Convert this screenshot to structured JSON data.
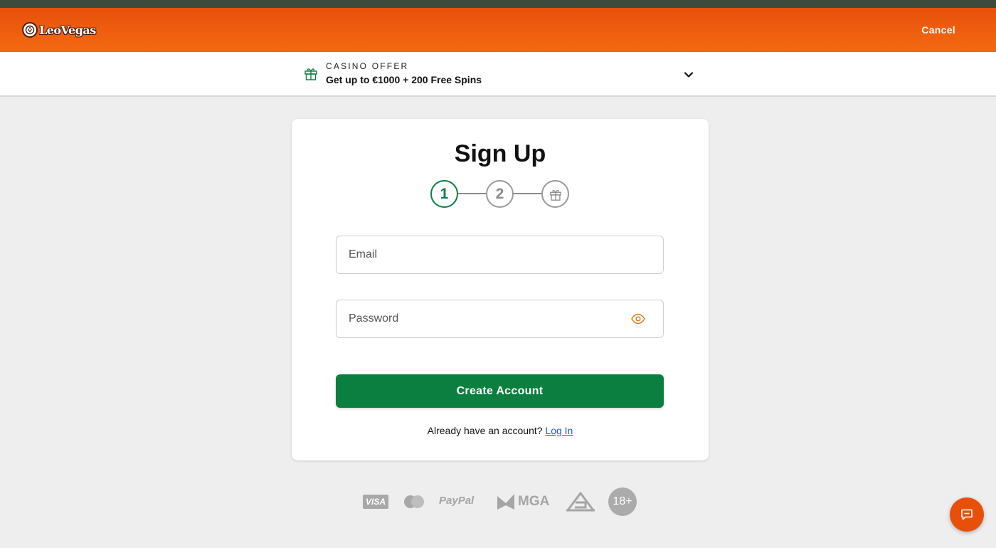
{
  "header": {
    "brand": "LeoVegas",
    "cancel_label": "Cancel"
  },
  "offer": {
    "kicker": "CASINO OFFER",
    "text": "Get up to €1000 + 200 Free Spins",
    "icon": "gift-icon"
  },
  "signup": {
    "title": "Sign Up",
    "steps": [
      {
        "label": "1",
        "state": "active"
      },
      {
        "label": "2",
        "state": "pending"
      },
      {
        "icon": "gift-icon",
        "state": "pending"
      }
    ],
    "email_placeholder": "Email",
    "password_placeholder": "Password",
    "create_label": "Create Account",
    "login_prompt": "Already have an account?",
    "login_link": "Log In"
  },
  "footer": {
    "payments": [
      {
        "name": "VISA",
        "icon": "visa-logo"
      },
      {
        "name": "Mastercard",
        "icon": "mastercard-logo"
      },
      {
        "name": "PayPal",
        "icon": "paypal-logo"
      },
      {
        "name": "MGA",
        "icon": "mga-logo"
      },
      {
        "name": "GA",
        "icon": "ga-logo"
      },
      {
        "name": "18+",
        "icon": "age-badge"
      }
    ]
  },
  "colors": {
    "brand_orange": "#e8500a",
    "primary_green": "#0b7f3f",
    "link_blue": "#1a5bd6",
    "background": "#eeeeee"
  }
}
